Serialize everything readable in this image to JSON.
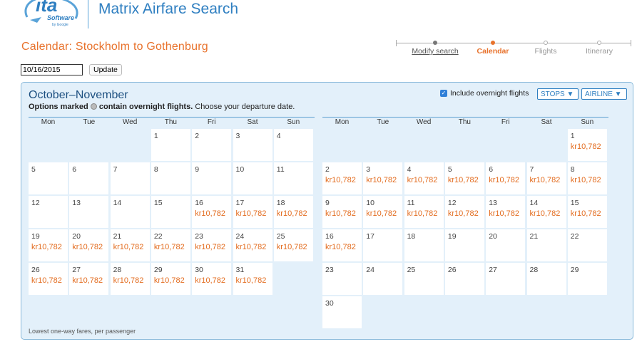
{
  "app": {
    "logo_text": "ita",
    "logo_sub": "Software",
    "logo_by": "by Google",
    "title": "Matrix Airfare Search"
  },
  "page_title": "Calendar: Stockholm to Gothenburg",
  "steps": [
    "Modify search",
    "Calendar",
    "Flights",
    "Itinerary"
  ],
  "date_input": {
    "value": "10/16/2015"
  },
  "update_label": "Update",
  "panel": {
    "month_title": "October–November",
    "subtitle_prefix": "Options marked",
    "subtitle_bold": "contain overnight flights.",
    "subtitle_suffix": "Choose your departure date.",
    "overnight_label": "Include overnight flights",
    "stops_label": "STOPS ▼",
    "airline_label": "AIRLINE ▼",
    "footnote": "Lowest one-way fares, per passenger"
  },
  "weekdays": [
    "Mon",
    "Tue",
    "Wed",
    "Thu",
    "Fri",
    "Sat",
    "Sun"
  ],
  "months": [
    {
      "name": "October",
      "weeks": [
        [
          null,
          null,
          null,
          {
            "day": "1"
          },
          {
            "day": "2"
          },
          {
            "day": "3"
          },
          {
            "day": "4"
          }
        ],
        [
          {
            "day": "5"
          },
          {
            "day": "6"
          },
          {
            "day": "7"
          },
          {
            "day": "8"
          },
          {
            "day": "9"
          },
          {
            "day": "10"
          },
          {
            "day": "11"
          }
        ],
        [
          {
            "day": "12"
          },
          {
            "day": "13"
          },
          {
            "day": "14"
          },
          {
            "day": "15"
          },
          {
            "day": "16",
            "price": "kr10,782"
          },
          {
            "day": "17",
            "price": "kr10,782"
          },
          {
            "day": "18",
            "price": "kr10,782"
          }
        ],
        [
          {
            "day": "19",
            "price": "kr10,782"
          },
          {
            "day": "20",
            "price": "kr10,782"
          },
          {
            "day": "21",
            "price": "kr10,782"
          },
          {
            "day": "22",
            "price": "kr10,782"
          },
          {
            "day": "23",
            "price": "kr10,782"
          },
          {
            "day": "24",
            "price": "kr10,782"
          },
          {
            "day": "25",
            "price": "kr10,782"
          }
        ],
        [
          {
            "day": "26",
            "price": "kr10,782"
          },
          {
            "day": "27",
            "price": "kr10,782"
          },
          {
            "day": "28",
            "price": "kr10,782"
          },
          {
            "day": "29",
            "price": "kr10,782"
          },
          {
            "day": "30",
            "price": "kr10,782"
          },
          {
            "day": "31",
            "price": "kr10,782"
          },
          null
        ]
      ]
    },
    {
      "name": "November",
      "weeks": [
        [
          null,
          null,
          null,
          null,
          null,
          null,
          {
            "day": "1",
            "price": "kr10,782"
          }
        ],
        [
          {
            "day": "2",
            "price": "kr10,782"
          },
          {
            "day": "3",
            "price": "kr10,782"
          },
          {
            "day": "4",
            "price": "kr10,782"
          },
          {
            "day": "5",
            "price": "kr10,782"
          },
          {
            "day": "6",
            "price": "kr10,782"
          },
          {
            "day": "7",
            "price": "kr10,782"
          },
          {
            "day": "8",
            "price": "kr10,782"
          }
        ],
        [
          {
            "day": "9",
            "price": "kr10,782"
          },
          {
            "day": "10",
            "price": "kr10,782"
          },
          {
            "day": "11",
            "price": "kr10,782"
          },
          {
            "day": "12",
            "price": "kr10,782"
          },
          {
            "day": "13",
            "price": "kr10,782"
          },
          {
            "day": "14",
            "price": "kr10,782"
          },
          {
            "day": "15",
            "price": "kr10,782"
          }
        ],
        [
          {
            "day": "16",
            "price": "kr10,782"
          },
          {
            "day": "17"
          },
          {
            "day": "18"
          },
          {
            "day": "19"
          },
          {
            "day": "20"
          },
          {
            "day": "21"
          },
          {
            "day": "22"
          }
        ],
        [
          {
            "day": "23"
          },
          {
            "day": "24"
          },
          {
            "day": "25"
          },
          {
            "day": "26"
          },
          {
            "day": "27"
          },
          {
            "day": "28"
          },
          {
            "day": "29"
          }
        ],
        [
          {
            "day": "30"
          },
          null,
          null,
          null,
          null,
          null,
          null
        ]
      ]
    }
  ],
  "colors": {
    "brand_blue": "#2f7fc1",
    "accent_orange": "#e8722c",
    "price_orange": "#e36c1f",
    "panel_bg": "#e3f0fa"
  }
}
